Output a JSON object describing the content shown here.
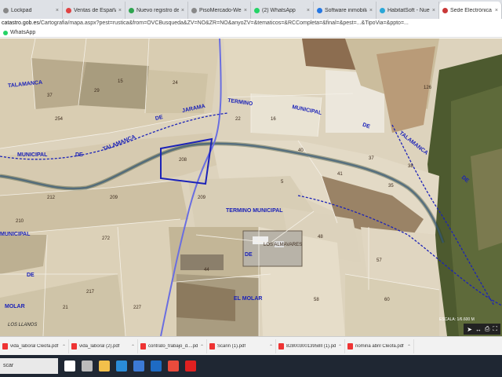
{
  "browser": {
    "tabs": [
      {
        "title": "Lockpad",
        "icon_color": "#888888"
      },
      {
        "title": "Ventas de España y U",
        "icon_color": "#e04343"
      },
      {
        "title": "Nuevo registro de su",
        "icon_color": "#2ea44f"
      },
      {
        "title": "PisoMercado-Web",
        "icon_color": "#888888"
      },
      {
        "title": "(2) WhatsApp",
        "icon_color": "#25d366"
      },
      {
        "title": "Software inmobiliario",
        "icon_color": "#2577e3"
      },
      {
        "title": "HabitatSoft - Nueva",
        "icon_color": "#2aa7d8"
      },
      {
        "title": "Sede Electrónica del",
        "icon_color": "#c93838",
        "active": true
      }
    ],
    "url_host": "catastro.gob.es",
    "url_path": "/Cartografia/mapa.aspx?pest=rustica&from=OVCBusqueda&ZV=NO&ZR=NO&anyoZV=&tematicos=&RCCompleta=&final=&pest=...&TipoVia=&ppto=..."
  },
  "bookmarks": [
    {
      "label": "WhatsApp"
    }
  ],
  "map": {
    "labels": [
      {
        "text": "TALAMANCA",
        "kind": "blue"
      },
      {
        "text": "TALAMANCA",
        "kind": "blue"
      },
      {
        "text": "DE",
        "kind": "blue"
      },
      {
        "text": "JARAMA",
        "kind": "blue"
      },
      {
        "text": "TERMINO",
        "kind": "blue"
      },
      {
        "text": "MUNICIPAL",
        "kind": "blue"
      },
      {
        "text": "DE",
        "kind": "blue"
      },
      {
        "text": "TALAMANCA",
        "kind": "blue"
      },
      {
        "text": "MUNICIPAL",
        "kind": "blue"
      },
      {
        "text": "DE",
        "kind": "blue"
      },
      {
        "text": "TERMINO MUNICIPAL",
        "kind": "blue"
      },
      {
        "text": "DE",
        "kind": "blue"
      },
      {
        "text": "EL MOLAR",
        "kind": "blue"
      },
      {
        "text": "MUNICIPAL",
        "kind": "blue"
      },
      {
        "text": "DE",
        "kind": "blue"
      },
      {
        "text": "MOLAR",
        "kind": "blue"
      },
      {
        "text": "LOS ALMAVARES",
        "kind": "dark"
      },
      {
        "text": "LOS LLANOS",
        "kind": "italic"
      },
      {
        "text": "DE",
        "kind": "blue"
      }
    ],
    "parcel_numbers": [
      "37",
      "29",
      "15",
      "24",
      "22",
      "16",
      "208",
      "209",
      "212",
      "210",
      "209",
      "272",
      "5",
      "35",
      "37",
      "38",
      "217",
      "44",
      "48",
      "57",
      "58",
      "60",
      "40",
      "41",
      "227",
      "21",
      "254",
      "126"
    ],
    "tools": {
      "icons": [
        "pointer-icon",
        "measure-icon",
        "print-icon",
        "fullscreen-icon"
      ]
    },
    "scale_text": "ESCALA: 1/6.600 M"
  },
  "downloads": [
    {
      "name": "vida_laboral Cleofa.pdf"
    },
    {
      "name": "vida_laboral (2).pdf"
    },
    {
      "name": "contrato_trabajo_d....pdf"
    },
    {
      "name": "Scann (1).pdf"
    },
    {
      "name": "8280030013958ll (1).pdf"
    },
    {
      "name": "nomina abril Cleofa.pdf"
    }
  ],
  "taskbar": {
    "search_text": "scar",
    "apps": [
      {
        "name": "windows-icon",
        "color": "#ffffff"
      },
      {
        "name": "task-view-icon",
        "color": "#bbbbbb"
      },
      {
        "name": "file-explorer-icon",
        "color": "#f2c04b"
      },
      {
        "name": "edge-icon",
        "color": "#2a8cd8"
      },
      {
        "name": "store-icon",
        "color": "#3c7ad6"
      },
      {
        "name": "outlook-icon",
        "color": "#1e6bc4"
      },
      {
        "name": "chrome-icon",
        "color": "#e94b3c"
      },
      {
        "name": "acrobat-icon",
        "color": "#e02020"
      }
    ]
  },
  "colors": {
    "boundary": "#1b22b8",
    "river": "#3a67a6",
    "parcel_line": "#f5f1e8"
  }
}
